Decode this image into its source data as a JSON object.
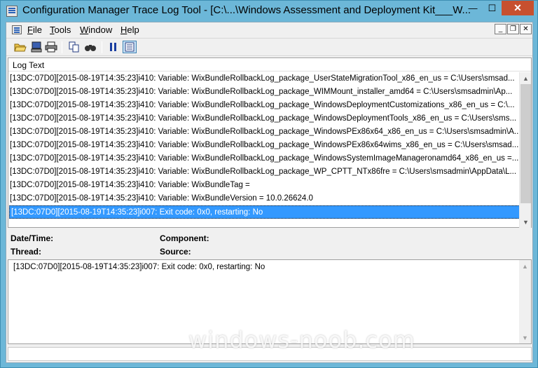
{
  "window": {
    "title": "Configuration Manager Trace Log Tool - [C:\\...\\Windows Assessment and Deployment Kit___W...",
    "minimize": "—",
    "maximize": "☐",
    "close": "✕"
  },
  "menu": {
    "items": [
      "File",
      "Tools",
      "Window",
      "Help"
    ],
    "mdi_minimize": "_",
    "mdi_restore": "❐",
    "mdi_close": "✕"
  },
  "toolbar": {
    "tools": [
      "open-icon",
      "computer-icon",
      "print-icon",
      "copy-icon",
      "find-icon",
      "pause-icon",
      "filter-icon"
    ]
  },
  "log": {
    "column_header": "Log Text",
    "rows": [
      "[13DC:07D0][2015-08-19T14:35:23]i410: Variable: WixBundleRollbackLog_package_UserStateMigrationTool_x86_en_us = C:\\Users\\smsad...",
      "[13DC:07D0][2015-08-19T14:35:23]i410: Variable: WixBundleRollbackLog_package_WIMMount_installer_amd64 = C:\\Users\\smsadmin\\Ap...",
      "[13DC:07D0][2015-08-19T14:35:23]i410: Variable: WixBundleRollbackLog_package_WindowsDeploymentCustomizations_x86_en_us = C:\\...",
      "[13DC:07D0][2015-08-19T14:35:23]i410: Variable: WixBundleRollbackLog_package_WindowsDeploymentTools_x86_en_us = C:\\Users\\sms...",
      "[13DC:07D0][2015-08-19T14:35:23]i410: Variable: WixBundleRollbackLog_package_WindowsPEx86x64_x86_en_us = C:\\Users\\smsadmin\\A...",
      "[13DC:07D0][2015-08-19T14:35:23]i410: Variable: WixBundleRollbackLog_package_WindowsPEx86x64wims_x86_en_us = C:\\Users\\smsad...",
      "[13DC:07D0][2015-08-19T14:35:23]i410: Variable: WixBundleRollbackLog_package_WindowsSystemImageManageronamd64_x86_en_us =...",
      "[13DC:07D0][2015-08-19T14:35:23]i410: Variable: WixBundleRollbackLog_package_WP_CPTT_NTx86fre = C:\\Users\\smsadmin\\AppData\\L...",
      "[13DC:07D0][2015-08-19T14:35:23]i410: Variable: WixBundleTag =",
      "[13DC:07D0][2015-08-19T14:35:23]i410: Variable: WixBundleVersion = 10.0.26624.0",
      "[13DC:07D0][2015-08-19T14:35:23]i007: Exit code: 0x0, restarting: No"
    ],
    "selected_index": 10
  },
  "details": {
    "datetime_label": "Date/Time:",
    "component_label": "Component:",
    "thread_label": "Thread:",
    "source_label": "Source:",
    "text": "[13DC:07D0][2015-08-19T14:35:23]i007: Exit code: 0x0, restarting: No"
  },
  "watermark": "windows-noob.com"
}
